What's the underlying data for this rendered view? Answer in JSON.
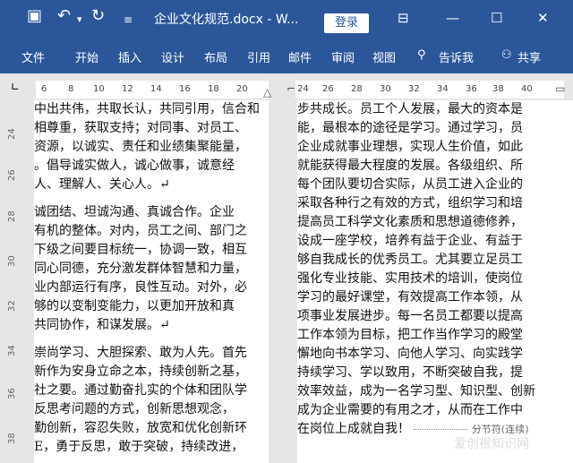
{
  "titlebar": {
    "save_icon": "save-icon",
    "undo_icon": "undo-icon",
    "redo_icon": "redo-icon",
    "doc_title": "企业文化规范.docx - W...",
    "login_label": "登录",
    "ribbon_display_icon": "ribbon-display-icon",
    "minimize_label": "—",
    "maximize_label": "☐",
    "close_label": "✕"
  },
  "ribbon": {
    "tabs": [
      "文件",
      "开始",
      "插入",
      "设计",
      "布局",
      "引用",
      "邮件",
      "审阅",
      "视图"
    ],
    "tell_me": "告诉我",
    "share": "共享"
  },
  "ruler": {
    "left_ticks": [
      "6",
      "8",
      "10",
      "12",
      "14",
      "16",
      "18",
      "20"
    ],
    "right_ticks": [
      "24",
      "26",
      "28",
      "30",
      "32",
      "34",
      "36",
      "38",
      "40"
    ]
  },
  "vruler": [
    "24",
    "26",
    "28",
    "30",
    "32",
    "34",
    "36",
    "38"
  ],
  "left_page": [
    "中出共伟，共取长认，共同引用，信合和",
    "相尊重，获取支持；对同事、对员工、",
    "资源，以诚实、责任和业绩集聚能量，",
    "。倡导诚实做人，诚心做事，诚意经",
    "人、理解人、关心人。↵",
    "",
    "诚团结、坦诚沟通、真诚合作。企业",
    "有机的整体。对内，员工之间、部门之",
    "下级之间要目标统一，协调一致，相互",
    "同心同德，充分激发群体智慧和力量，",
    "业内部运行有序，良性互动。对外，必",
    "够的以变制变能力，以更加开放和真",
    "共同协作，和谋发展。↵",
    "",
    "崇尚学习、大胆探索、敢为人先。首先",
    "新作为安身立命之本，持续创新之基，",
    "社之要。通过勤奋扎实的个体和团队学",
    "反思考问题的方式，创新思想观念，",
    "勤创新，容忍失败，放宽和优化创新环",
    "E，勇于反思，敢于突破，持续改进，"
  ],
  "right_page": [
    "步共成长。员工个人发展，最大的资本是",
    "能，最根本的途径是学习。通过学习，员",
    "企业成就事业理想，实现人生价值，如此",
    "就能获得最大程度的发展。各级组织、所",
    "每个团队要切合实际，从员工进入企业的",
    "采取各种行之有效的方式，组织学习和培",
    "提高员工科学文化素质和思想道德修养，",
    "设成一座学校，培养有益于企业、有益于",
    "够自我成长的优秀员工。尤其要立足员工",
    "强化专业技能、实用技术的培训，使岗位",
    "学习的最好课堂，有效提高工作本领，从",
    "项事业发展进步。每一名员工都要以提高",
    "工作本领为目标，把工作当作学习的殿堂",
    "懈地向书本学习、向他人学习、向实践学",
    "持续学习、学以致用，不断突破自我，提",
    "效率效益，成为一名学习型、知识型、创新",
    "成为企业需要的有用之才，从而在工作中",
    "在岗位上成就自我！",
    "分节符(连续)"
  ],
  "watermark": "爱创根知识网"
}
